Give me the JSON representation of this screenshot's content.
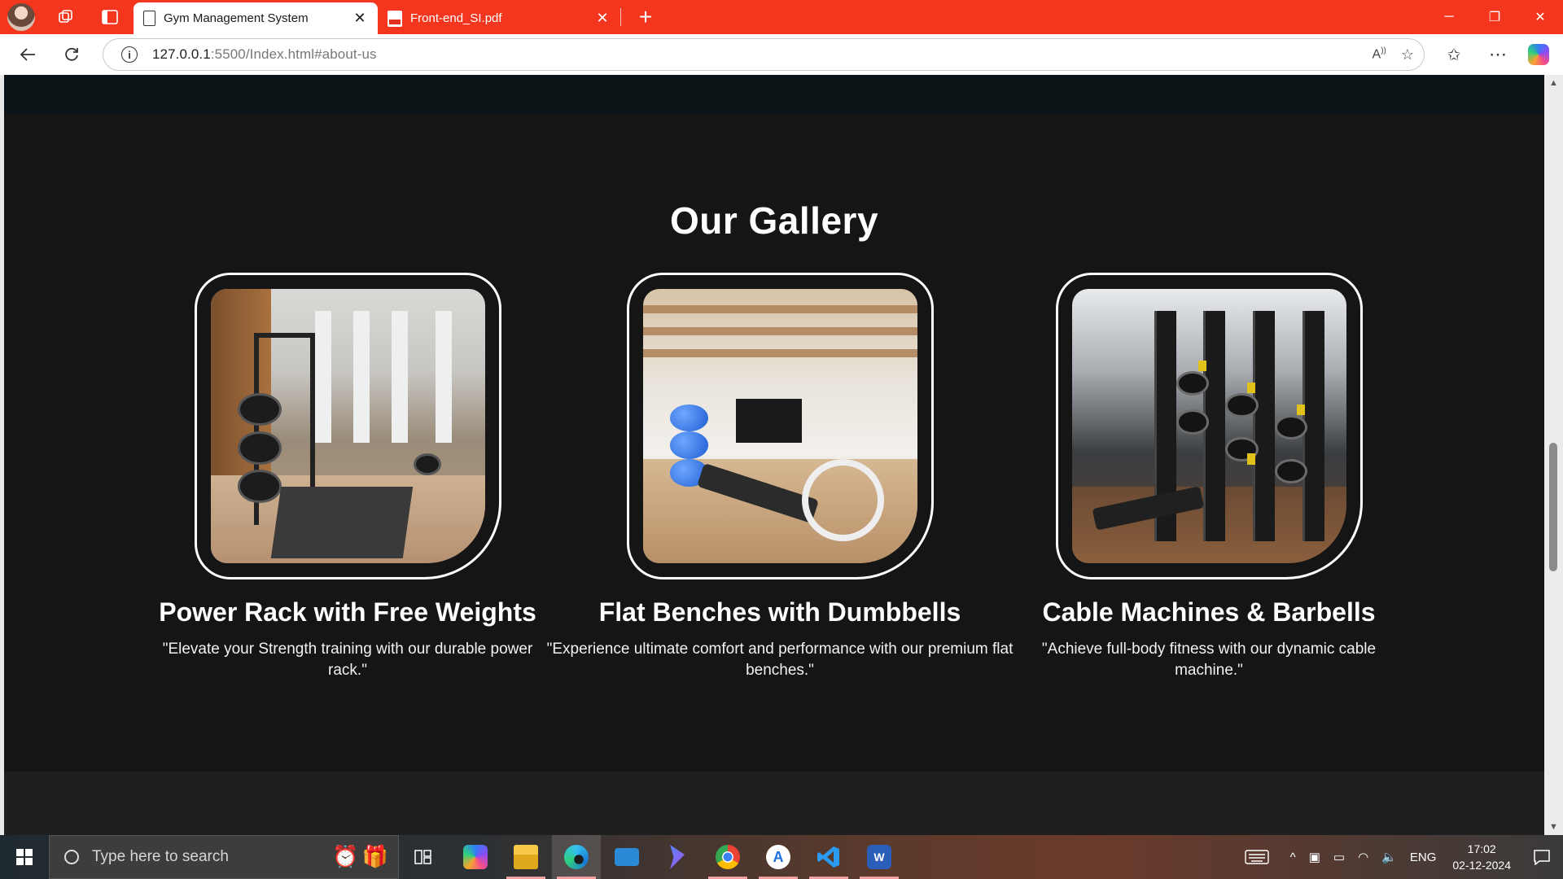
{
  "browser": {
    "tabs": [
      {
        "title": "Gym Management System",
        "active": true
      },
      {
        "title": "Front-end_SI.pdf",
        "active": false
      }
    ],
    "url_host": "127.0.0.1",
    "url_rest": ":5500/Index.html#about-us"
  },
  "page": {
    "gallery_title": "Our Gallery",
    "cards": [
      {
        "title": "Power Rack with Free Weights",
        "description": "\"Elevate your Strength training with our durable power rack.\""
      },
      {
        "title": "Flat Benches with Dumbbells",
        "description": "\"Experience ultimate comfort and performance with our premium flat benches.\""
      },
      {
        "title": "Cable Machines & Barbells",
        "description": "\"Achieve full-body fitness with our dynamic cable machine.\""
      }
    ]
  },
  "taskbar": {
    "search_placeholder": "Type here to search",
    "language": "ENG",
    "time": "17:02",
    "date": "02-12-2024"
  },
  "colors": {
    "browser_accent": "#f5361e",
    "page_background": "#151515"
  }
}
